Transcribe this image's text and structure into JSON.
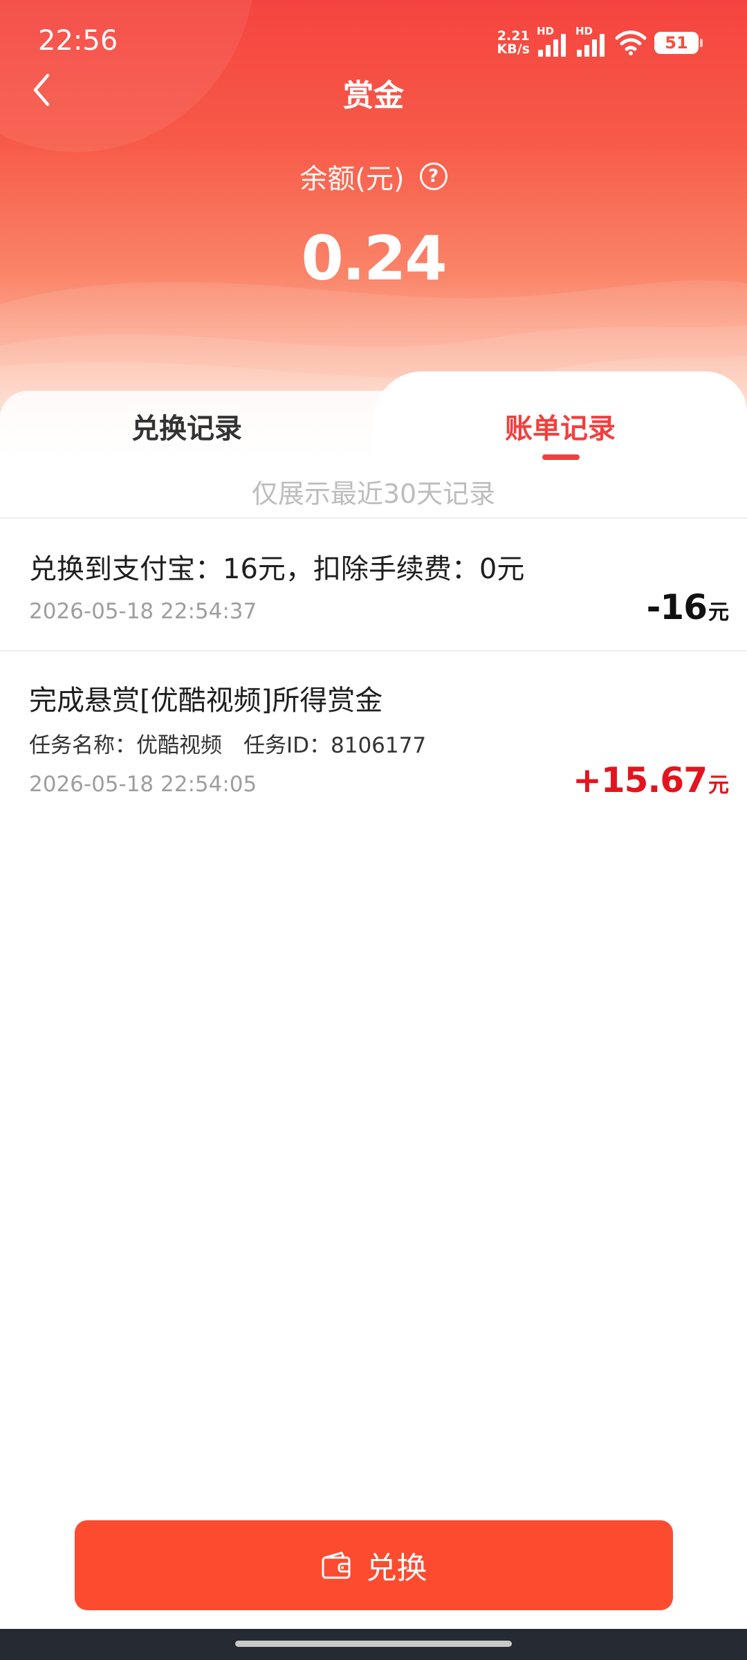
{
  "status_bar": {
    "time": "22:56",
    "net_speed_value": "2.21",
    "net_speed_unit": "KB/s",
    "hd_label_1": "HD",
    "hd_label_2": "HD",
    "battery": "51"
  },
  "header": {
    "title": "赏金",
    "balance_label": "余额(元)",
    "help_symbol": "?",
    "balance_value": "0.24"
  },
  "tabs": [
    {
      "label": "兑换记录",
      "active": false
    },
    {
      "label": "账单记录",
      "active": true
    }
  ],
  "notice": "仅展示最近30天记录",
  "records": [
    {
      "title": "兑换到支付宝：16元，扣除手续费：0元",
      "time": "2026-05-18 22:54:37",
      "amount": "-16",
      "unit": "元"
    },
    {
      "title": "完成悬赏[优酷视频]所得赏金",
      "detail": "任务名称：优酷视频　任务ID：8106177",
      "time": "2026-05-18 22:54:05",
      "amount": "+15.67",
      "unit": "元"
    }
  ],
  "bottom": {
    "exchange_label": "兑换"
  },
  "colors": {
    "accent": "#f1403e",
    "button": "#fd4b30",
    "positive_amount": "#e3141e",
    "muted_text": "#9e9e9e"
  }
}
